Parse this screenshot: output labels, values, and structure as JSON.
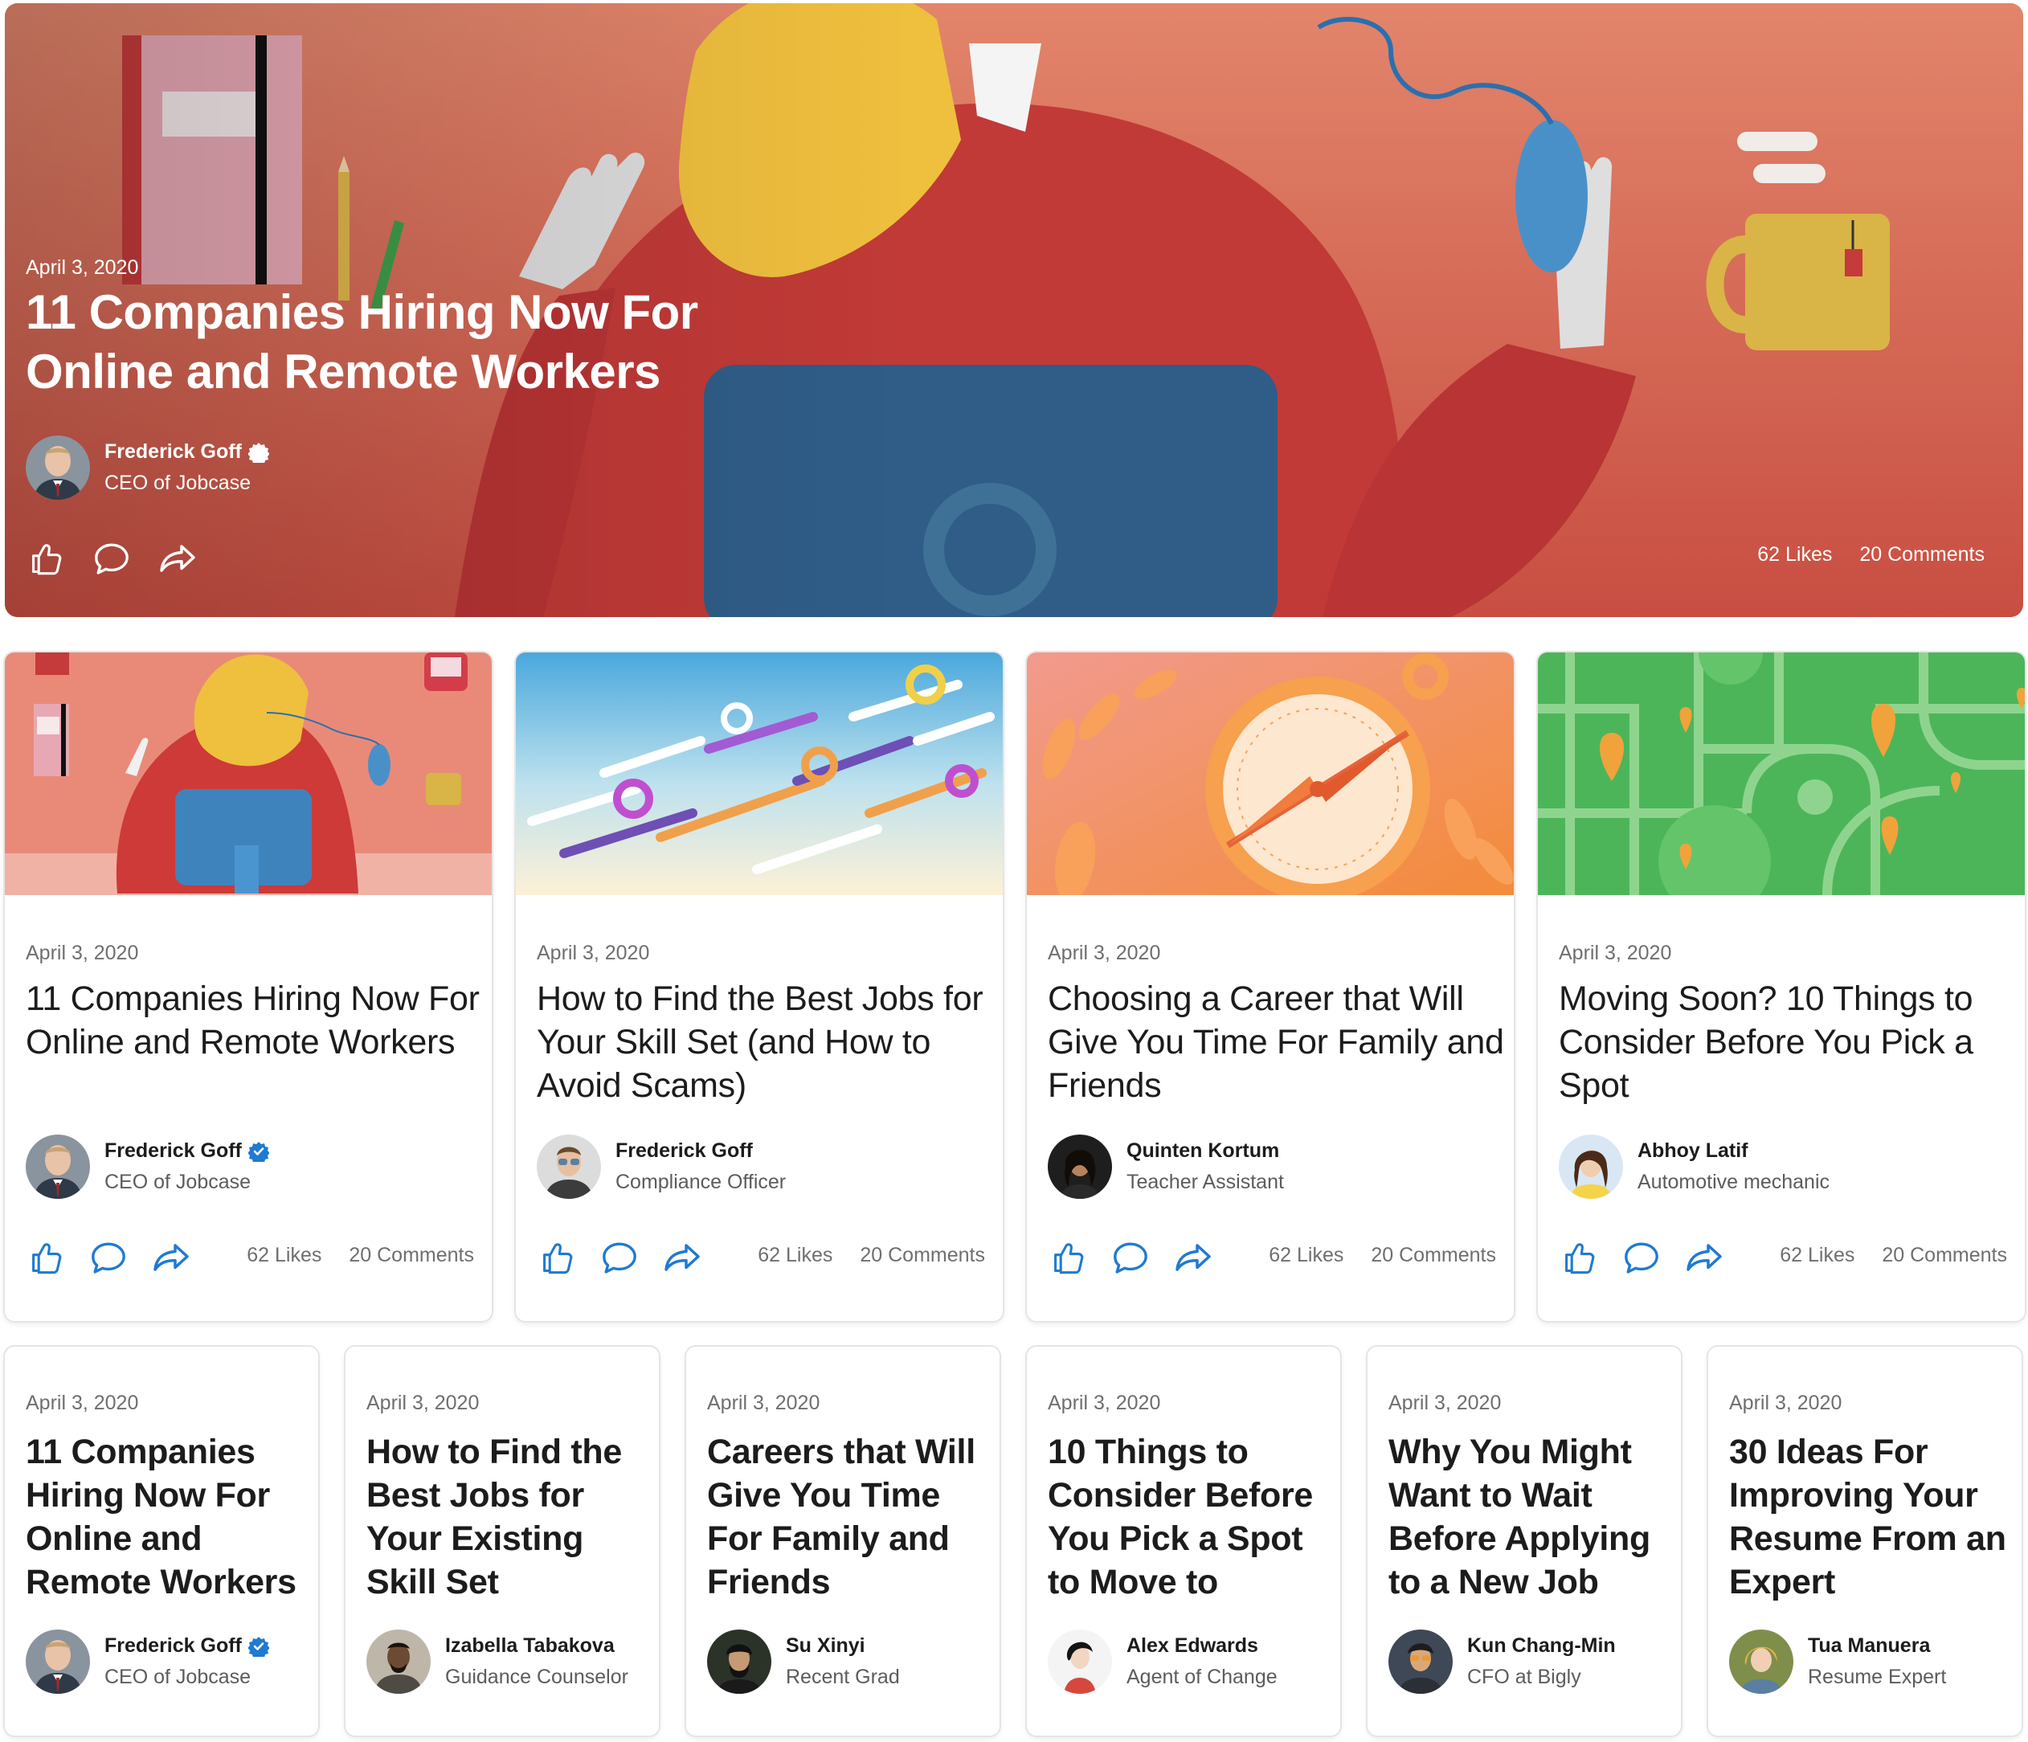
{
  "colors": {
    "accent_blue": "#1f7ad2",
    "verified_blue": "#1f7ad2",
    "text_primary": "#1c1c1c",
    "text_secondary": "#6f6f6f",
    "hero_bg": "#dd7b62"
  },
  "icons": {
    "like": "thumbs-up-icon",
    "comment": "speech-bubble-icon",
    "share": "share-arrow-icon",
    "verified": "verified-check-icon"
  },
  "hero": {
    "date": "April 3, 2020",
    "title": "11 Companies Hiring Now For Online and Remote Workers",
    "author_name": "Frederick Goff",
    "author_verified": true,
    "author_role": "CEO of Jobcase",
    "likes": "62 Likes",
    "comments": "20 Comments"
  },
  "featured_cards": [
    {
      "date": "April 3, 2020",
      "title": "11 Companies Hiring Now For Online and Remote Workers",
      "author_name": "Frederick Goff",
      "author_verified": true,
      "author_role": "CEO of Jobcase",
      "likes": "62 Likes",
      "comments": "20 Comments"
    },
    {
      "date": "April 3, 2020",
      "title": "How to Find the Best Jobs for Your Skill Set (and How to Avoid Scams)",
      "author_name": "Frederick Goff",
      "author_verified": false,
      "author_role": "Compliance Officer",
      "likes": "62 Likes",
      "comments": "20 Comments"
    },
    {
      "date": "April 3, 2020",
      "title": "Choosing a Career that Will Give You Time For Family and Friends",
      "author_name": "Quinten Kortum",
      "author_verified": false,
      "author_role": "Teacher Assistant",
      "likes": "62 Likes",
      "comments": "20 Comments"
    },
    {
      "date": "April 3, 2020",
      "title": "Moving Soon? 10 Things to Consider Before You Pick a Spot",
      "author_name": "Abhoy Latif",
      "author_verified": false,
      "author_role": "Automotive mechanic",
      "likes": "62 Likes",
      "comments": "20 Comments"
    }
  ],
  "compact_cards": [
    {
      "date": "April 3, 2020",
      "title": "11 Companies Hiring Now For Online and Remote Workers",
      "author_name": "Frederick Goff",
      "author_verified": true,
      "author_role": "CEO of Jobcase"
    },
    {
      "date": "April 3, 2020",
      "title": "How to Find the Best Jobs for Your Existing Skill Set",
      "author_name": "Izabella Tabakova",
      "author_verified": false,
      "author_role": "Guidance Counselor"
    },
    {
      "date": "April 3, 2020",
      "title": "Careers that Will Give You Time For Family and Friends",
      "author_name": "Su Xinyi",
      "author_verified": false,
      "author_role": "Recent Grad"
    },
    {
      "date": "April 3, 2020",
      "title": "10 Things to Consider Before You Pick a Spot to Move to",
      "author_name": "Alex Edwards",
      "author_verified": false,
      "author_role": "Agent of Change"
    },
    {
      "date": "April 3, 2020",
      "title": "Why You Might Want to Wait Before Applying to a New Job",
      "author_name": "Kun Chang-Min",
      "author_verified": false,
      "author_role": "CFO at Bigly"
    },
    {
      "date": "April 3, 2020",
      "title": "30 Ideas For Improving Your Resume From an Expert",
      "author_name": "Tua Manuera",
      "author_verified": false,
      "author_role": "Resume Expert"
    }
  ]
}
